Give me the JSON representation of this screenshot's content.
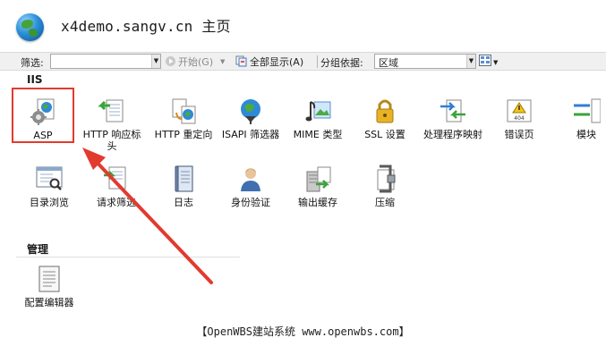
{
  "header": {
    "title": "x4demo.sangv.cn 主页",
    "icon": "globe-icon"
  },
  "toolbar": {
    "filter_label": "筛选:",
    "filter_value": "",
    "start_label": "开始(G)",
    "show_all_label": "全部显示(A)",
    "group_by_label": "分组依据:",
    "group_by_value": "区域"
  },
  "sections": {
    "iis": {
      "title": "IIS",
      "items": [
        {
          "label": "ASP",
          "icon": "asp-icon",
          "selected": true
        },
        {
          "label": "HTTP 响应标头",
          "icon": "http-response-headers-icon"
        },
        {
          "label": "HTTP 重定向",
          "icon": "http-redirect-icon"
        },
        {
          "label": "ISAPI 筛选器",
          "icon": "isapi-filters-icon"
        },
        {
          "label": "MIME 类型",
          "icon": "mime-types-icon"
        },
        {
          "label": "SSL 设置",
          "icon": "ssl-settings-icon"
        },
        {
          "label": "处理程序映射",
          "icon": "handler-mappings-icon"
        },
        {
          "label": "错误页",
          "icon": "error-pages-icon"
        },
        {
          "label": "模块",
          "icon": "modules-icon"
        },
        {
          "label": "目录浏览",
          "icon": "directory-browsing-icon"
        },
        {
          "label": "请求筛选",
          "icon": "request-filtering-icon"
        },
        {
          "label": "日志",
          "icon": "logging-icon"
        },
        {
          "label": "身份验证",
          "icon": "authentication-icon"
        },
        {
          "label": "输出缓存",
          "icon": "output-caching-icon"
        },
        {
          "label": "压缩",
          "icon": "compression-icon"
        }
      ]
    },
    "management": {
      "title": "管理",
      "items": [
        {
          "label": "配置编辑器",
          "icon": "configuration-editor-icon"
        }
      ]
    }
  },
  "footer": {
    "text": "【OpenWBS建站系统 www.openwbs.com】"
  },
  "colors": {
    "annotation": "#e23a2f",
    "toolbar_bg": "#f0f0f0"
  }
}
